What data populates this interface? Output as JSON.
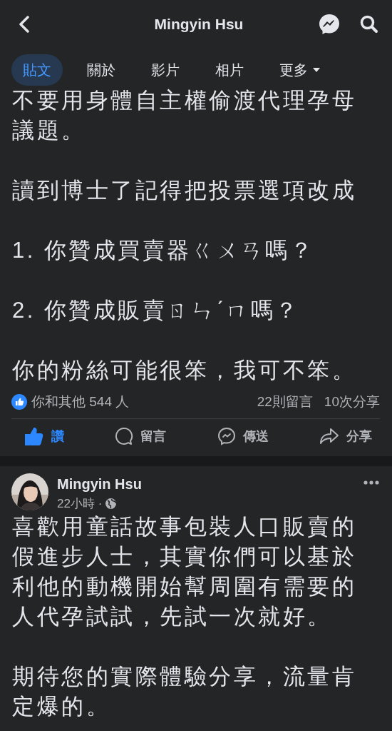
{
  "header": {
    "title": "Mingyin Hsu"
  },
  "tabs": [
    {
      "label": "貼文",
      "selected": true,
      "has_menu": false
    },
    {
      "label": "關於",
      "selected": false,
      "has_menu": false
    },
    {
      "label": "影片",
      "selected": false,
      "has_menu": false
    },
    {
      "label": "相片",
      "selected": false,
      "has_menu": false
    },
    {
      "label": "更多",
      "selected": false,
      "has_menu": true
    }
  ],
  "posts": [
    {
      "paragraphs": [
        "不要用身體自主權偷渡代理孕母議題。",
        "讀到博士了記得把投票選項改成",
        "1. 你贊成買賣器ㄍㄨㄢ嗎？",
        "2. 你贊成販賣ㄖㄣˊㄇ嗎？",
        "你的粉絲可能很笨，我可不笨。"
      ],
      "reactions": "你和其他 544 人",
      "comments": "22則留言",
      "shares": "10次分享",
      "actions": [
        {
          "kind": "like",
          "label": "讚",
          "selected": true
        },
        {
          "kind": "comment",
          "label": "留言",
          "selected": false
        },
        {
          "kind": "send",
          "label": "傳送",
          "selected": false
        },
        {
          "kind": "share",
          "label": "分享",
          "selected": false
        }
      ]
    },
    {
      "author": "Mingyin Hsu",
      "time": "22小時 ·",
      "paragraphs": [
        "喜歡用童話故事包裝人口販賣的假進步人士，其實你們可以基於利他的動機開始幫周圍有需要的人代孕試試，先試一次就好。",
        "期待您的實際體驗分享，流量肯定爆的。"
      ]
    }
  ]
}
